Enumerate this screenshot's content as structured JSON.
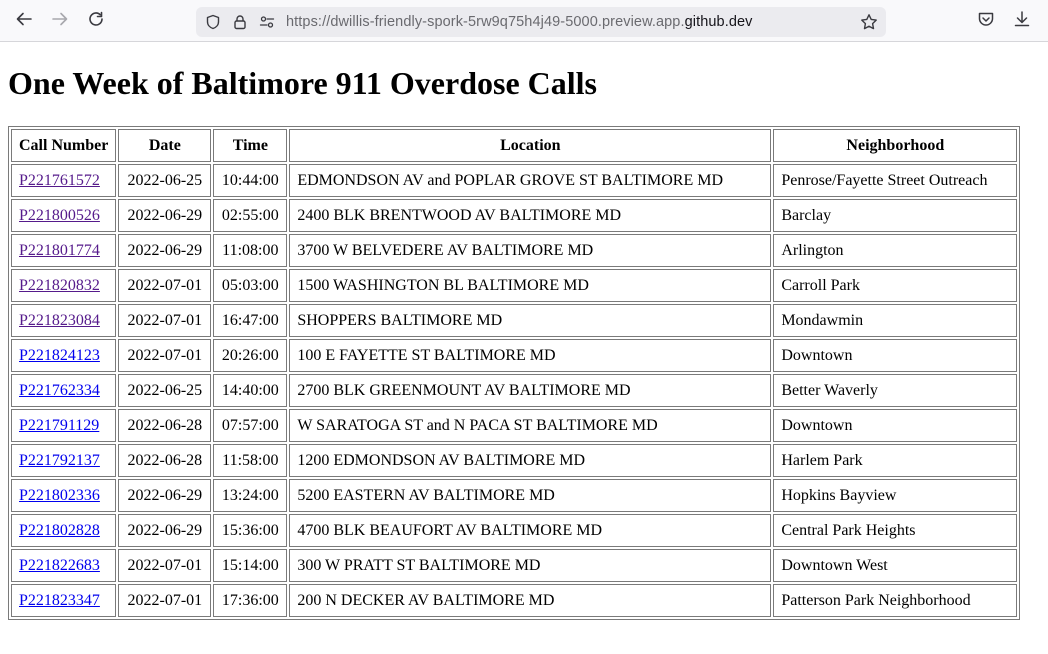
{
  "browser": {
    "url_prefix": "https://dwillis-friendly-spork-5rw9q75h4j49-5000.preview.app.",
    "url_domain": "github.dev"
  },
  "page": {
    "title": "One Week of Baltimore 911 Overdose Calls"
  },
  "table": {
    "headers": [
      "Call Number",
      "Date",
      "Time",
      "Location",
      "Neighborhood"
    ],
    "rows": [
      {
        "call": "P221761572",
        "date": "2022-06-25",
        "time": "10:44:00",
        "location": "EDMONDSON AV and POPLAR GROVE ST BALTIMORE MD",
        "neighborhood": "Penrose/Fayette Street Outreach",
        "visited": true
      },
      {
        "call": "P221800526",
        "date": "2022-06-29",
        "time": "02:55:00",
        "location": "2400 BLK BRENTWOOD AV BALTIMORE MD",
        "neighborhood": "Barclay",
        "visited": true
      },
      {
        "call": "P221801774",
        "date": "2022-06-29",
        "time": "11:08:00",
        "location": "3700 W BELVEDERE AV BALTIMORE MD",
        "neighborhood": "Arlington",
        "visited": true
      },
      {
        "call": "P221820832",
        "date": "2022-07-01",
        "time": "05:03:00",
        "location": "1500 WASHINGTON BL BALTIMORE MD",
        "neighborhood": "Carroll Park",
        "visited": true
      },
      {
        "call": "P221823084",
        "date": "2022-07-01",
        "time": "16:47:00",
        "location": "SHOPPERS BALTIMORE MD",
        "neighborhood": "Mondawmin",
        "visited": true
      },
      {
        "call": "P221824123",
        "date": "2022-07-01",
        "time": "20:26:00",
        "location": "100 E FAYETTE ST BALTIMORE MD",
        "neighborhood": "Downtown",
        "visited": false
      },
      {
        "call": "P221762334",
        "date": "2022-06-25",
        "time": "14:40:00",
        "location": "2700 BLK GREENMOUNT AV BALTIMORE MD",
        "neighborhood": "Better Waverly",
        "visited": false
      },
      {
        "call": "P221791129",
        "date": "2022-06-28",
        "time": "07:57:00",
        "location": "W SARATOGA ST and N PACA ST BALTIMORE MD",
        "neighborhood": "Downtown",
        "visited": false
      },
      {
        "call": "P221792137",
        "date": "2022-06-28",
        "time": "11:58:00",
        "location": "1200 EDMONDSON AV BALTIMORE MD",
        "neighborhood": "Harlem Park",
        "visited": false
      },
      {
        "call": "P221802336",
        "date": "2022-06-29",
        "time": "13:24:00",
        "location": "5200 EASTERN AV BALTIMORE MD",
        "neighborhood": "Hopkins Bayview",
        "visited": false
      },
      {
        "call": "P221802828",
        "date": "2022-06-29",
        "time": "15:36:00",
        "location": "4700 BLK BEAUFORT AV BALTIMORE MD",
        "neighborhood": "Central Park Heights",
        "visited": false
      },
      {
        "call": "P221822683",
        "date": "2022-07-01",
        "time": "15:14:00",
        "location": "300 W PRATT ST BALTIMORE MD",
        "neighborhood": "Downtown West",
        "visited": false
      },
      {
        "call": "P221823347",
        "date": "2022-07-01",
        "time": "17:36:00",
        "location": "200 N DECKER AV BALTIMORE MD",
        "neighborhood": "Patterson Park Neighborhood",
        "visited": false
      }
    ]
  }
}
